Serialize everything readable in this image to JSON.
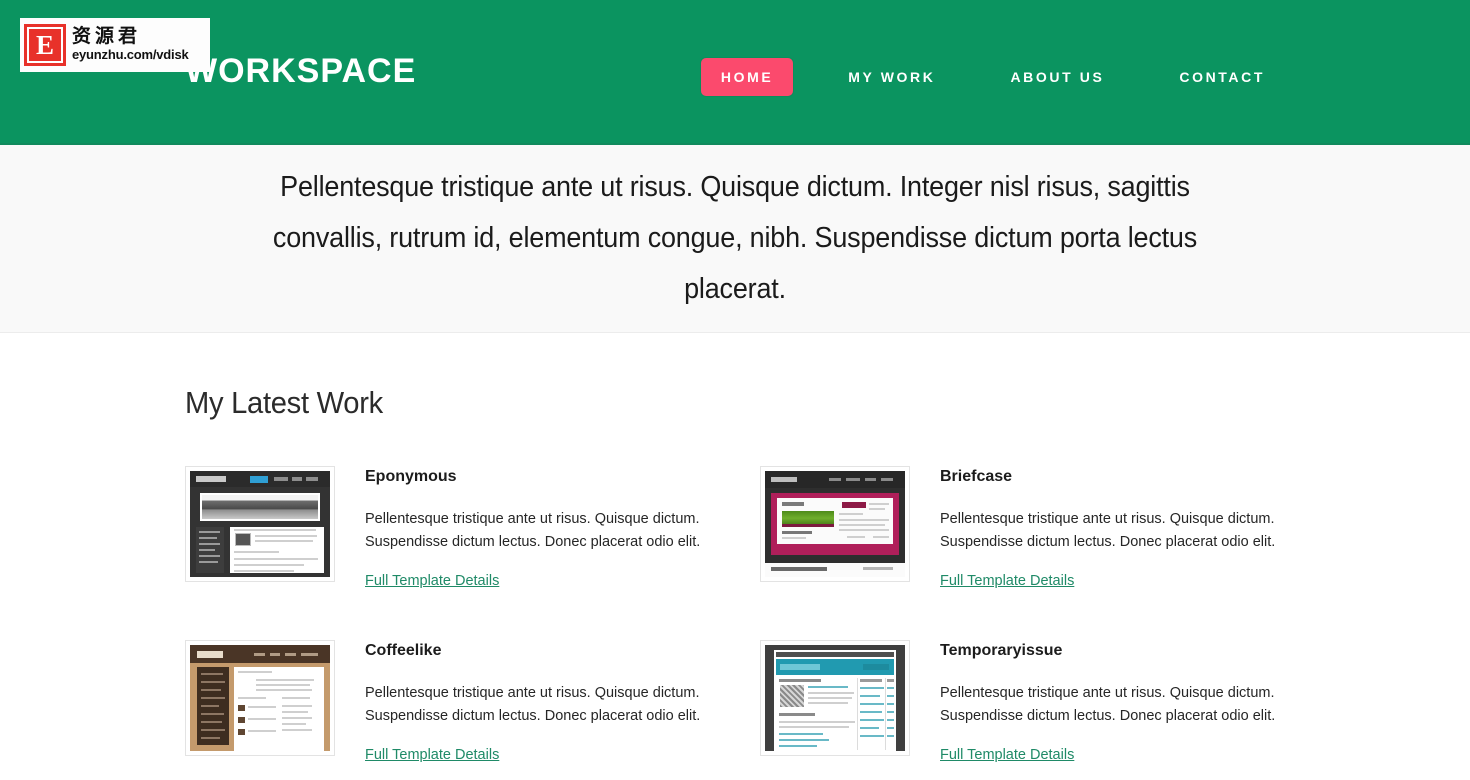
{
  "header": {
    "brand": "WORKSPACE",
    "nav": [
      {
        "label": "HOME",
        "active": true
      },
      {
        "label": "MY WORK",
        "active": false
      },
      {
        "label": "ABOUT US",
        "active": false
      },
      {
        "label": "CONTACT",
        "active": false
      }
    ],
    "colors": {
      "background": "#0b9460",
      "active_nav_background": "#fb4a6d",
      "nav_text": "#ffffff"
    }
  },
  "watermark": {
    "badge_letter": "E",
    "chinese_text": "资源君",
    "url_text": "eyunzhu.com/vdisk",
    "badge_color": "#e8312a"
  },
  "hero": {
    "text": "Pellentesque tristique ante ut risus. Quisque dictum. Integer nisl risus, sagittis convallis, rutrum id, elementum congue, nibh. Suspendisse dictum porta lectus placerat.",
    "background": "#f9f9f9"
  },
  "main": {
    "section_title": "My Latest Work",
    "link_color": "#1f8a67",
    "items": [
      {
        "title": "Eponymous",
        "description": "Pellentesque tristique ante ut risus. Quisque dictum. Suspendisse dictum lectus. Donec placerat odio elit.",
        "link_label": "Full Template Details",
        "thumbnail_name": "eponymous-thumbnail",
        "thumbnail_theme": "#333333"
      },
      {
        "title": "Briefcase",
        "description": "Pellentesque tristique ante ut risus. Quisque dictum. Suspendisse dictum lectus. Donec placerat odio elit.",
        "link_label": "Full Template Details",
        "thumbnail_name": "briefcase-thumbnail",
        "thumbnail_theme": "#b01f5a"
      },
      {
        "title": "Coffeelike",
        "description": "Pellentesque tristique ante ut risus. Quisque dictum. Suspendisse dictum lectus. Donec placerat odio elit.",
        "link_label": "Full Template Details",
        "thumbnail_name": "coffeelike-thumbnail",
        "thumbnail_theme": "#c49a6c"
      },
      {
        "title": "Temporaryissue",
        "description": "Pellentesque tristique ante ut risus. Quisque dictum. Suspendisse dictum lectus. Donec placerat odio elit.",
        "link_label": "Full Template Details",
        "thumbnail_name": "temporaryissue-thumbnail",
        "thumbnail_theme": "#219ab0"
      }
    ]
  }
}
